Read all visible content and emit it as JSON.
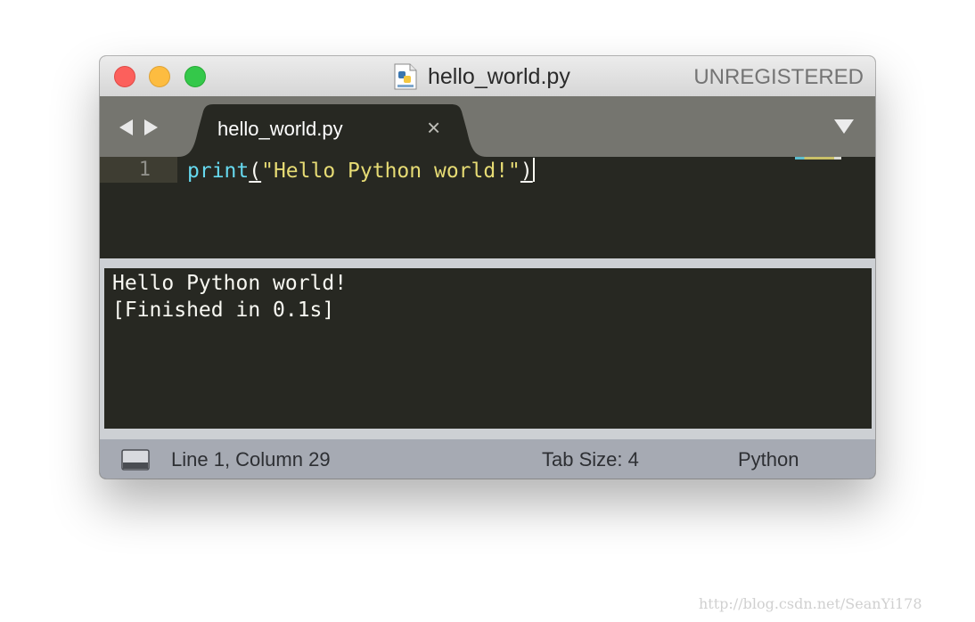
{
  "window": {
    "title": "hello_world.py",
    "badge": "UNREGISTERED",
    "file_icon": "python-file-icon"
  },
  "tabs": [
    {
      "label": "hello_world.py",
      "active": true,
      "close_glyph": "×"
    }
  ],
  "editor": {
    "line_number": "1",
    "tokens": {
      "func": "print",
      "open_paren": "(",
      "string": "\"Hello Python world!\"",
      "close_paren": ")"
    }
  },
  "output": {
    "lines": [
      "Hello Python world!",
      "[Finished in 0.1s]"
    ]
  },
  "status": {
    "position": "Line 1, Column 29",
    "tab_size": "Tab Size: 4",
    "syntax": "Python"
  },
  "watermark": "http://blog.csdn.net/SeanYi178",
  "colors": {
    "editor_bg": "#272822",
    "keyword": "#66d9ef",
    "string": "#e6db74",
    "text": "#f8f8f2",
    "tabbar": "#75756f",
    "statusbar": "#a6aab3"
  }
}
